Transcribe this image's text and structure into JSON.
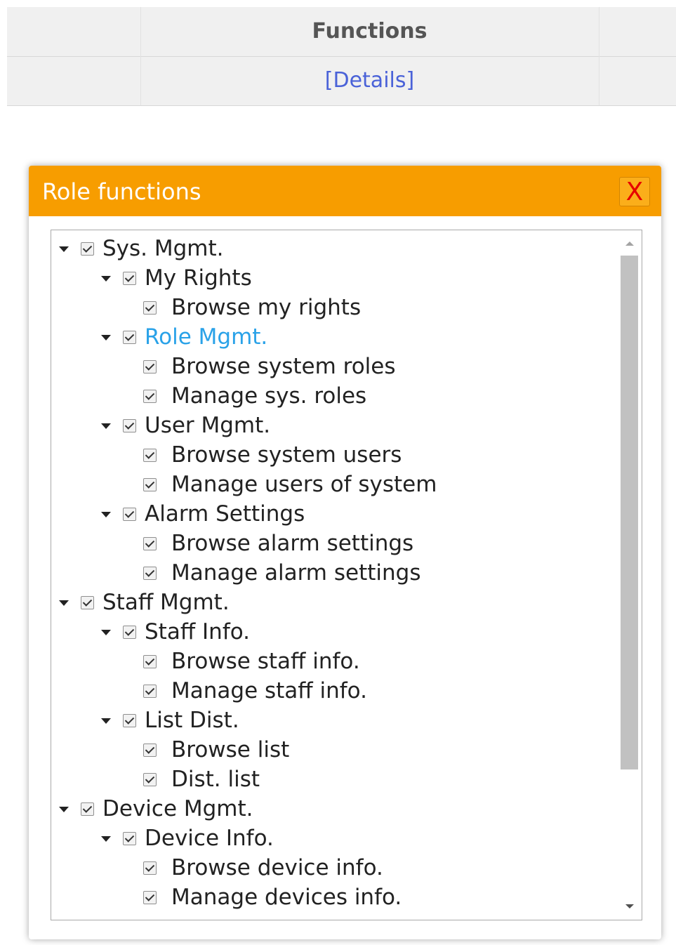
{
  "table": {
    "header": "Functions",
    "link": "[Details]"
  },
  "dialog": {
    "title": "Role functions",
    "close_label": "X",
    "accent_color": "#f79d00",
    "tree": [
      {
        "label": "Sys. Mgmt.",
        "level": 1,
        "expanded": true,
        "checked": true
      },
      {
        "label": "My Rights",
        "level": 2,
        "expanded": true,
        "checked": true
      },
      {
        "label": "Browse my rights",
        "level": 3,
        "checked": true
      },
      {
        "label": "Role Mgmt.",
        "level": 2,
        "expanded": true,
        "checked": true,
        "active": true
      },
      {
        "label": "Browse system roles",
        "level": 3,
        "checked": true
      },
      {
        "label": "Manage sys. roles",
        "level": 3,
        "checked": true
      },
      {
        "label": "User Mgmt.",
        "level": 2,
        "expanded": true,
        "checked": true
      },
      {
        "label": "Browse system users",
        "level": 3,
        "checked": true
      },
      {
        "label": "Manage users of system",
        "level": 3,
        "checked": true
      },
      {
        "label": "Alarm Settings",
        "level": 2,
        "expanded": true,
        "checked": true
      },
      {
        "label": "Browse alarm settings",
        "level": 3,
        "checked": true
      },
      {
        "label": "Manage alarm settings",
        "level": 3,
        "checked": true
      },
      {
        "label": "Staff Mgmt.",
        "level": 1,
        "expanded": true,
        "checked": true
      },
      {
        "label": "Staff Info.",
        "level": 2,
        "expanded": true,
        "checked": true
      },
      {
        "label": "Browse staff info.",
        "level": 3,
        "checked": true
      },
      {
        "label": "Manage staff info.",
        "level": 3,
        "checked": true
      },
      {
        "label": "List Dist.",
        "level": 2,
        "expanded": true,
        "checked": true
      },
      {
        "label": "Browse list",
        "level": 3,
        "checked": true
      },
      {
        "label": "Dist. list",
        "level": 3,
        "checked": true
      },
      {
        "label": "Device Mgmt.",
        "level": 1,
        "expanded": true,
        "checked": true
      },
      {
        "label": "Device Info.",
        "level": 2,
        "expanded": true,
        "checked": true
      },
      {
        "label": "Browse device info.",
        "level": 3,
        "checked": true
      },
      {
        "label": "Manage devices info.",
        "level": 3,
        "checked": true
      }
    ]
  }
}
